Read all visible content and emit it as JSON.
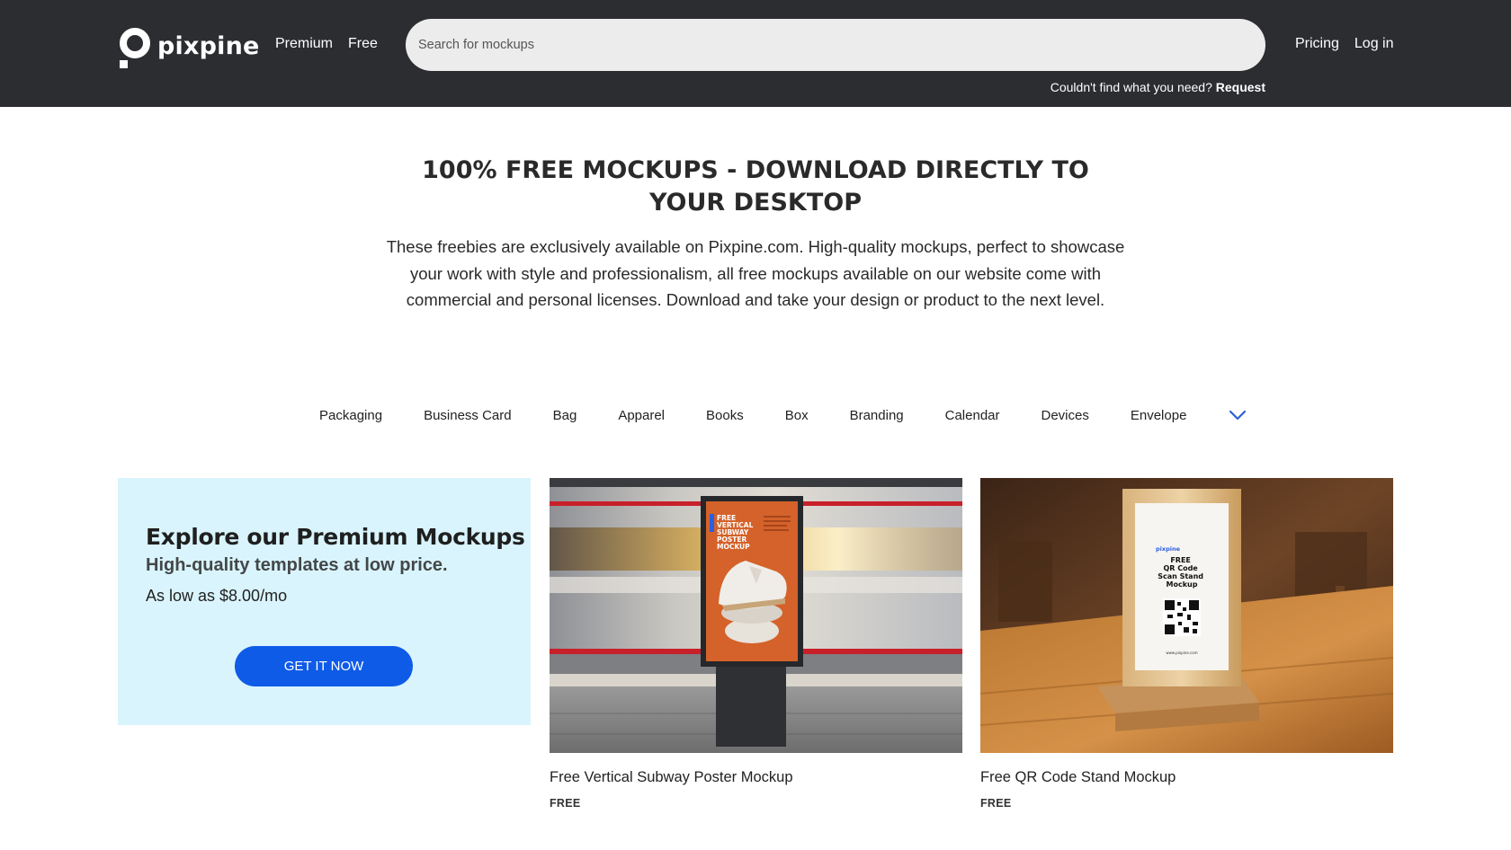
{
  "brand": {
    "name": "pixpine"
  },
  "nav": {
    "premium": "Premium",
    "free": "Free",
    "pricing": "Pricing",
    "login": "Log in"
  },
  "search": {
    "placeholder": "Search for mockups"
  },
  "request": {
    "prefix": "Couldn't find what you need?",
    "link": "Request"
  },
  "hero": {
    "title": "100% FREE MOCKUPS - DOWNLOAD DIRECTLY TO YOUR DESKTOP",
    "description": "These freebies are exclusively available on Pixpine.com. High-quality mockups, perfect to showcase your work with style and professionalism, all free mockups available on our website come with commercial and personal licenses. Download and take your design or product to the next level."
  },
  "categories": [
    "Packaging",
    "Business Card",
    "Bag",
    "Apparel",
    "Books",
    "Box",
    "Branding",
    "Calendar",
    "Devices",
    "Envelope"
  ],
  "promo": {
    "title": "Explore our Premium Mockups",
    "subtitle": "High-quality templates at low price.",
    "price": "As low as $8.00/mo",
    "button": "GET IT NOW"
  },
  "cards": [
    {
      "title": "Free Vertical Subway Poster Mockup",
      "badge": "FREE",
      "poster_text": [
        "FREE",
        "VERTICAL",
        "SUBWAY",
        "POSTER",
        "MOCKUP"
      ]
    },
    {
      "title": "Free QR Code Stand Mockup",
      "badge": "FREE",
      "stand_brand": "pixpine",
      "stand_text": [
        "FREE",
        "QR Code",
        "Scan Stand",
        "Mockup"
      ],
      "stand_url": "www.pixpine.com"
    }
  ],
  "colors": {
    "header_bg": "#2c2d31",
    "accent": "#0e5be8",
    "promo_bg": "#d9f4fc",
    "poster_orange": "#d4622a"
  },
  "icons": {
    "logo": "pixpine-logo-icon",
    "more_categories": "chevron-down-icon"
  }
}
